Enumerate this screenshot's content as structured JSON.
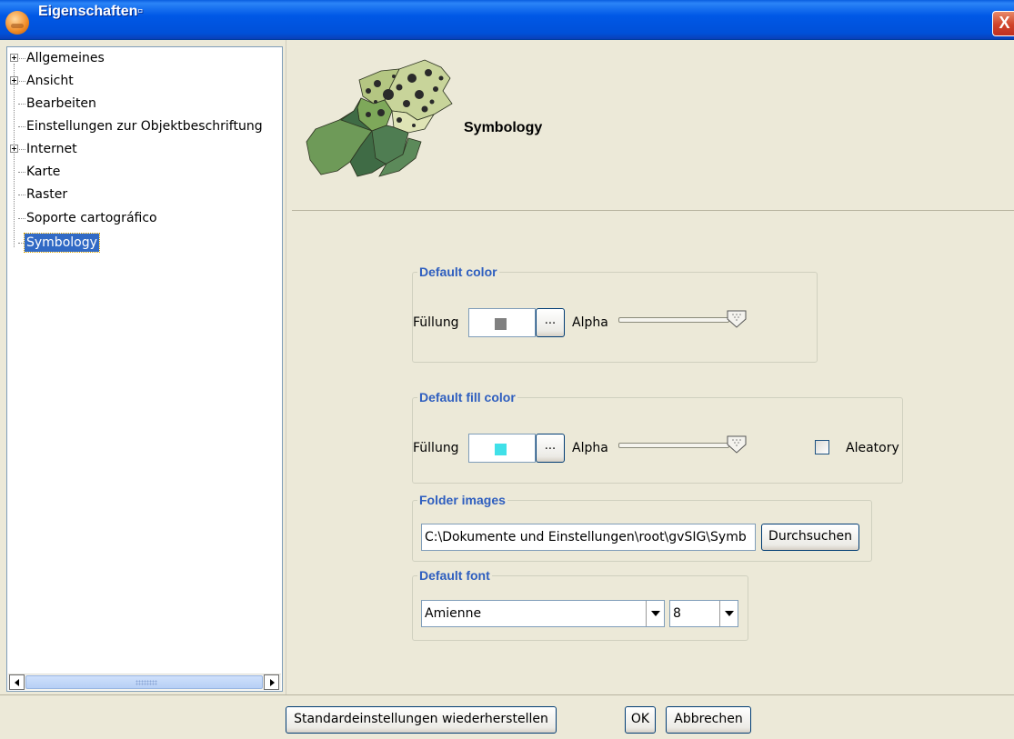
{
  "window": {
    "title": "Eigenschaften▫",
    "close_label": "X"
  },
  "tree": {
    "items": [
      {
        "label": "Allgemeines",
        "expandable": true
      },
      {
        "label": "Ansicht",
        "expandable": true
      },
      {
        "label": "Bearbeiten",
        "expandable": false
      },
      {
        "label": "Einstellungen zur Objektbeschriftung",
        "expandable": false
      },
      {
        "label": "Internet",
        "expandable": true
      },
      {
        "label": "Karte",
        "expandable": false
      },
      {
        "label": "Raster",
        "expandable": false
      },
      {
        "label": "Soporte cartográfico",
        "expandable": false
      },
      {
        "label": "Symbology",
        "expandable": false,
        "selected": true
      }
    ]
  },
  "header": {
    "title": "Symbology"
  },
  "default_color": {
    "title": "Default color",
    "fill_label": "Füllung",
    "swatch_color": "#808080",
    "dots_label": "...",
    "alpha_label": "Alpha",
    "alpha_value": 1.0
  },
  "default_fill_color": {
    "title": "Default fill color",
    "fill_label": "Füllung",
    "swatch_color": "#40e0e8",
    "dots_label": "...",
    "alpha_label": "Alpha",
    "alpha_value": 1.0,
    "aleatory_label": "Aleatory",
    "aleatory_checked": false
  },
  "folder_images": {
    "title": "Folder images",
    "path": "C:\\Dokumente und Einstellungen\\root\\gvSIG\\Symb",
    "browse_label": "Durchsuchen"
  },
  "default_font": {
    "title": "Default font",
    "font_name": "Amienne",
    "font_size": "8"
  },
  "buttons": {
    "restore_defaults": "Standardeinstellungen wiederherstellen",
    "ok": "OK",
    "cancel": "Abbrechen"
  },
  "colors": {
    "selection": "#316ac5",
    "group_title": "#2e5ebf",
    "dialog_bg": "#ece9d8"
  }
}
